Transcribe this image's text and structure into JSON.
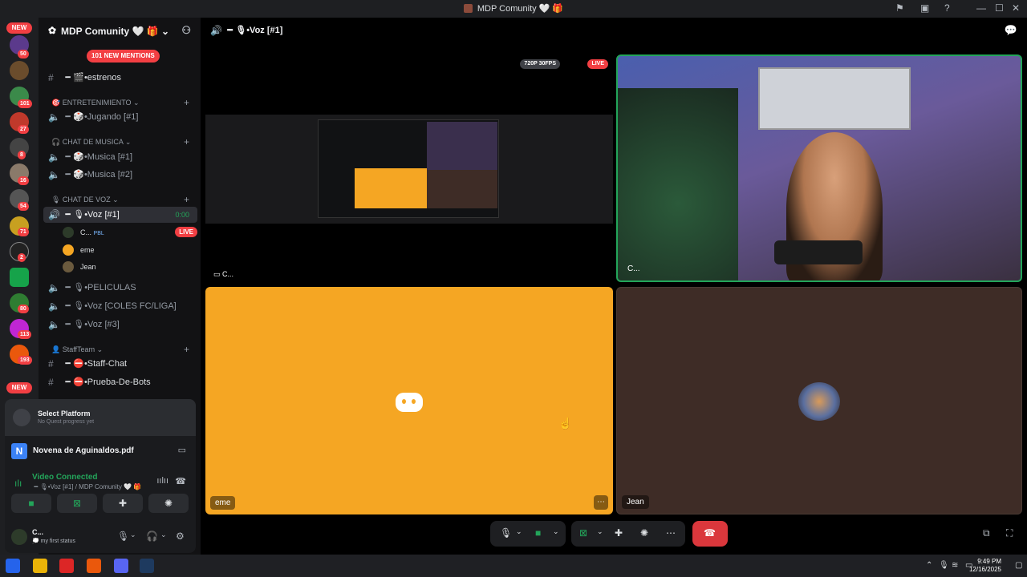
{
  "window": {
    "title": "MDP Comunity 🤍 🎁"
  },
  "guilds": {
    "badges": [
      "50",
      "101",
      "27",
      "8",
      "16",
      "54",
      "71",
      "2",
      "80",
      "113",
      "193"
    ],
    "new_label": "NEW"
  },
  "server": {
    "name": "MDP Comunity 🤍 🎁",
    "mentions_label": "101 NEW MENTIONS"
  },
  "channels": {
    "estrenos": "╺╸🎬•estrenos",
    "cat_entretenimiento": "🎯 ENTRETENIMIENTO",
    "jugando": "╺╸🎲•Jugando [#1]",
    "cat_musica": "🎧 CHAT DE MUSICA",
    "musica1": "╺╸🎲•Musica [#1]",
    "musica2": "╺╸🎲•Musica [#2]",
    "cat_voz": "🎙 CHAT DE VOZ",
    "voz1": "╺╸🎙•Voz [#1]",
    "voz1_timer": "0:00",
    "peliculas": "╺╸🎙•PELICULAS",
    "voz_coles": "╺╸🎙•Voz [COLES FC/LIGA]",
    "voz3": "╺╸🎙•Voz [#3]",
    "cat_staff": "👤 StaffTeam",
    "staff_chat": "╺╸⛔•Staff-Chat",
    "prueba_bots": "╺╸⛔•Prueba-De-Bots"
  },
  "voice_users": [
    {
      "name": "C...",
      "tag": "PBL",
      "live": "LIVE"
    },
    {
      "name": "eme"
    },
    {
      "name": "Jean"
    }
  ],
  "panel": {
    "quest_title": "Select Platform",
    "quest_sub": "No Quest progress yet",
    "activity_icon": "N",
    "activity_file": "Novena de Aguinaldos.pdf",
    "vc_status": "Video Connected",
    "vc_channel": "╺╸🎙•Voz [#1] / MDP Comunity 🤍 🎁",
    "user_name": "C...",
    "user_status": "💭 my first status"
  },
  "stage": {
    "channel": "╺╸🎙•Voz [#1]",
    "stream_quality": "720P 30FPS",
    "live": "LIVE",
    "stream_owner": "C...",
    "tiles": [
      {
        "name": "C...",
        "kind": "camera"
      },
      {
        "name": "eme",
        "kind": "avatar",
        "color": "#f5a623"
      },
      {
        "name": "Jean",
        "kind": "avatar",
        "color": "#3e2c26"
      }
    ]
  },
  "colors": {
    "accent_green": "#23a55a",
    "live_red": "#f23f43",
    "hangup_red": "#da373c",
    "eme_bg": "#f5a623"
  },
  "taskbar": {
    "time": "9:49 PM",
    "date": "12/16/2025"
  }
}
